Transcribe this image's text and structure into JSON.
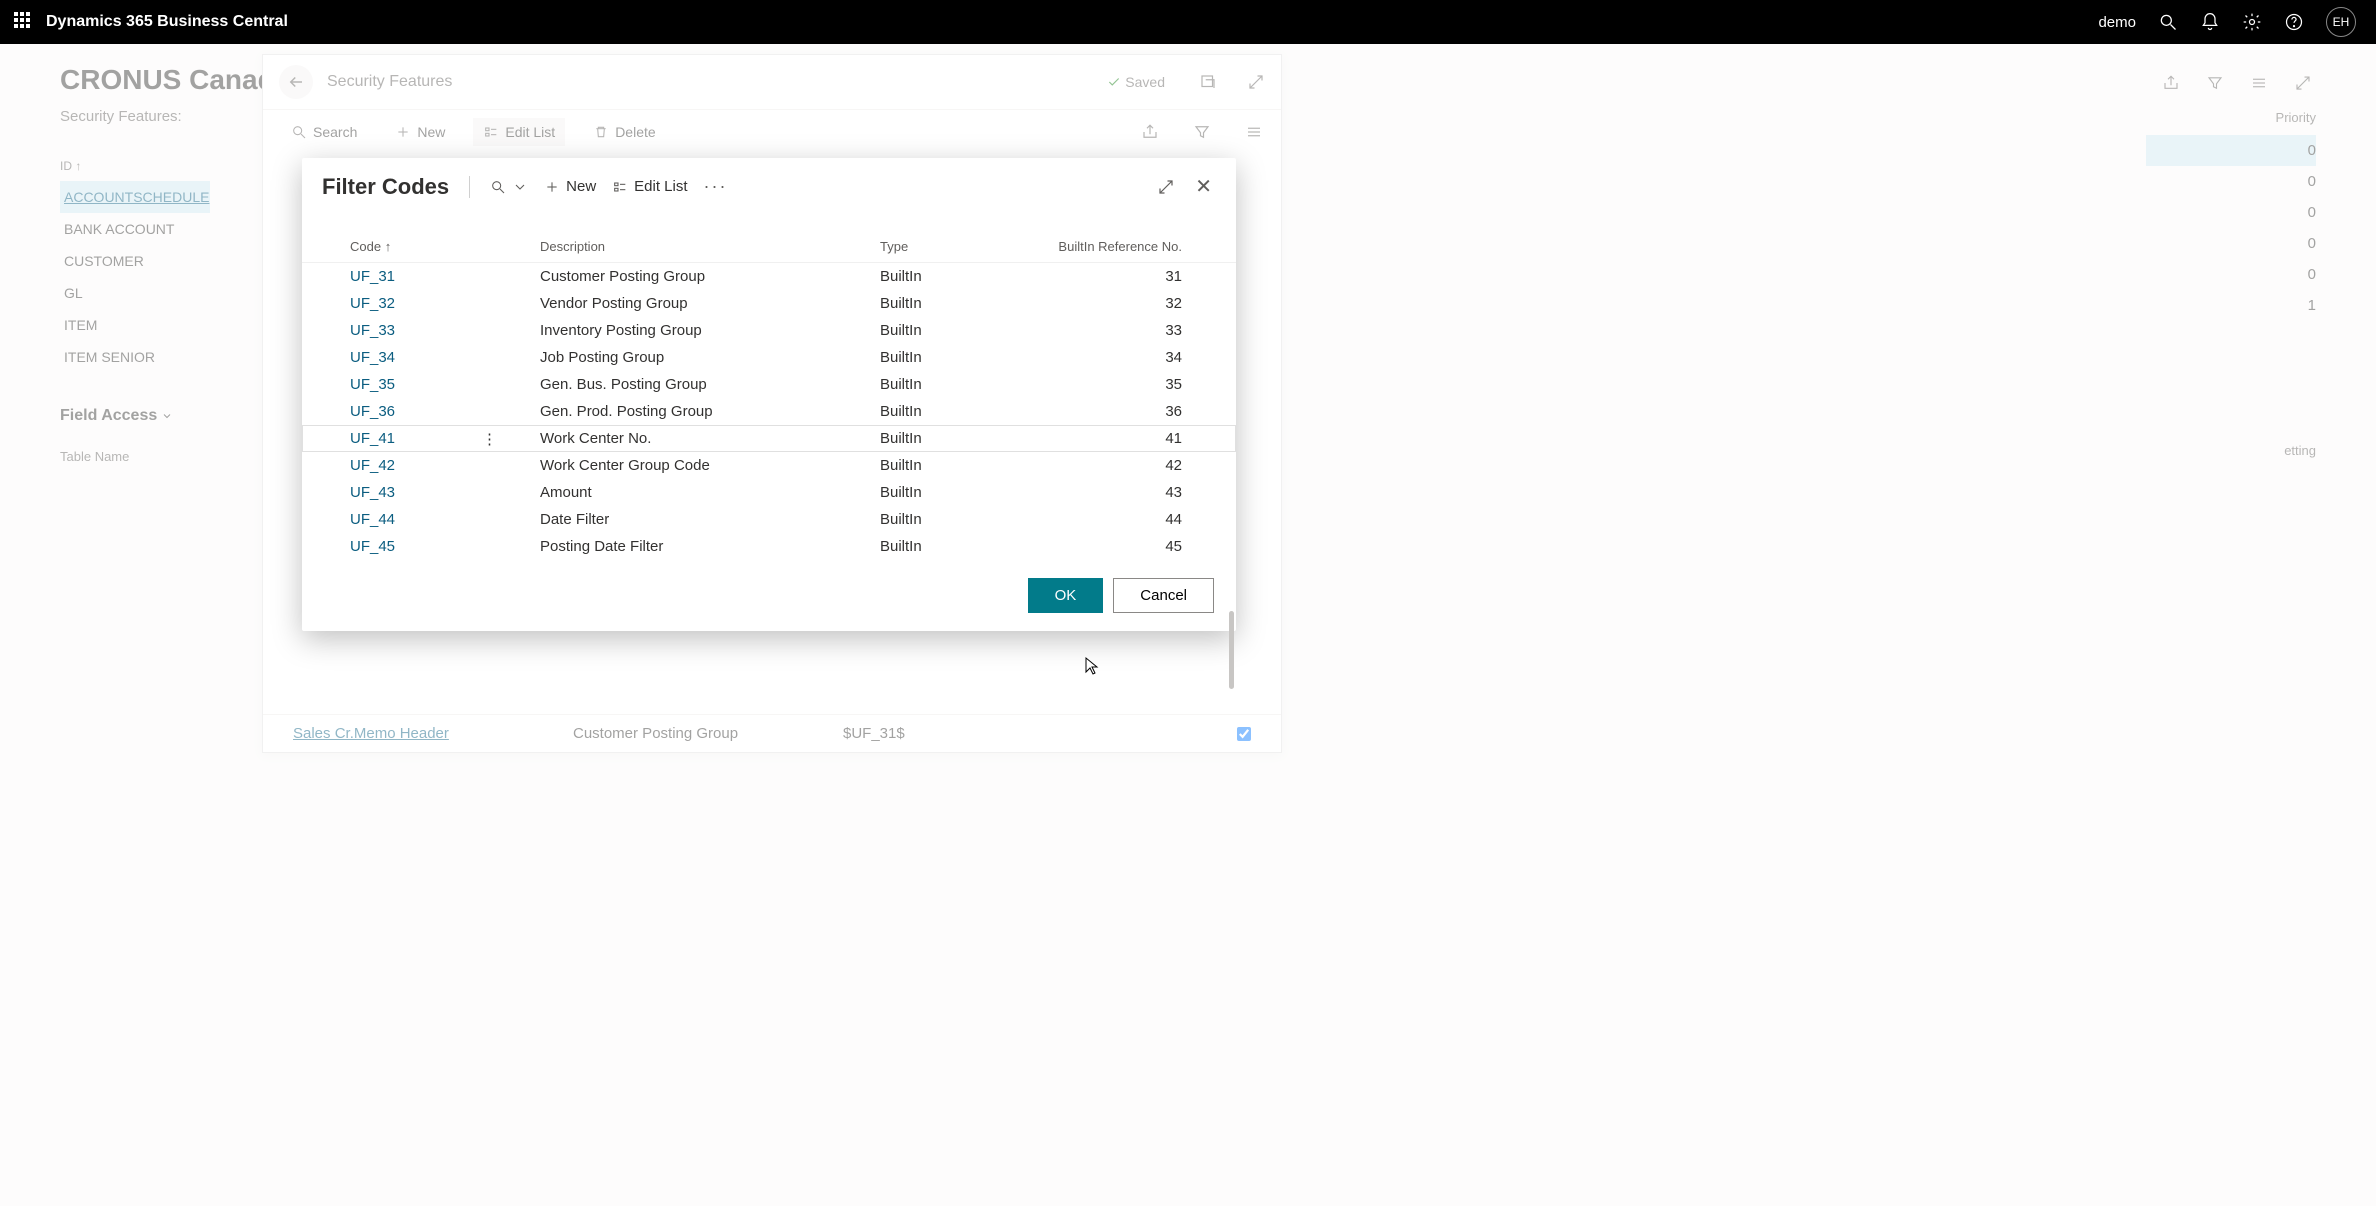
{
  "topbar": {
    "app_title": "Dynamics 365 Business Central",
    "user_label": "demo",
    "avatar": "EH"
  },
  "page": {
    "company": "CRONUS Canad",
    "sub_line": "Security Features:",
    "id_hdr": "ID ↑",
    "left_items": [
      "ACCOUNTSCHEDULE",
      "BANK ACCOUNT",
      "CUSTOMER",
      "GL",
      "ITEM",
      "ITEM SENIOR"
    ],
    "field_access": "Field Access",
    "table_name_hdr": "Table Name",
    "priority_hdr": "Priority",
    "priority_vals": [
      "0",
      "0",
      "0",
      "0",
      "0",
      "1"
    ],
    "partial_label": "etting"
  },
  "sec_panel": {
    "title": "Security Features",
    "saved": "Saved",
    "tools": {
      "search": "Search",
      "new": "New",
      "edit_list": "Edit List",
      "delete": "Delete"
    },
    "footer": {
      "link": "Sales Cr.Memo Header",
      "cpg": "Customer Posting Group",
      "code": "$UF_31$"
    }
  },
  "modal": {
    "title": "Filter Codes",
    "new": "New",
    "edit_list": "Edit List",
    "cols": {
      "code": "Code ↑",
      "desc": "Description",
      "type": "Type",
      "ref": "BuiltIn Reference No."
    },
    "rows": [
      {
        "code": "UF_31",
        "desc": "Customer Posting Group",
        "type": "BuiltIn",
        "ref": "31"
      },
      {
        "code": "UF_32",
        "desc": "Vendor Posting Group",
        "type": "BuiltIn",
        "ref": "32"
      },
      {
        "code": "UF_33",
        "desc": "Inventory Posting Group",
        "type": "BuiltIn",
        "ref": "33"
      },
      {
        "code": "UF_34",
        "desc": "Job Posting Group",
        "type": "BuiltIn",
        "ref": "34"
      },
      {
        "code": "UF_35",
        "desc": "Gen. Bus. Posting Group",
        "type": "BuiltIn",
        "ref": "35"
      },
      {
        "code": "UF_36",
        "desc": "Gen. Prod. Posting Group",
        "type": "BuiltIn",
        "ref": "36"
      },
      {
        "code": "UF_41",
        "desc": "Work Center No.",
        "type": "BuiltIn",
        "ref": "41"
      },
      {
        "code": "UF_42",
        "desc": "Work Center Group Code",
        "type": "BuiltIn",
        "ref": "42"
      },
      {
        "code": "UF_43",
        "desc": "Amount",
        "type": "BuiltIn",
        "ref": "43"
      },
      {
        "code": "UF_44",
        "desc": "Date Filter",
        "type": "BuiltIn",
        "ref": "44"
      },
      {
        "code": "UF_45",
        "desc": "Posting Date Filter",
        "type": "BuiltIn",
        "ref": "45"
      }
    ],
    "selected_index": 6,
    "ok": "OK",
    "cancel": "Cancel"
  }
}
